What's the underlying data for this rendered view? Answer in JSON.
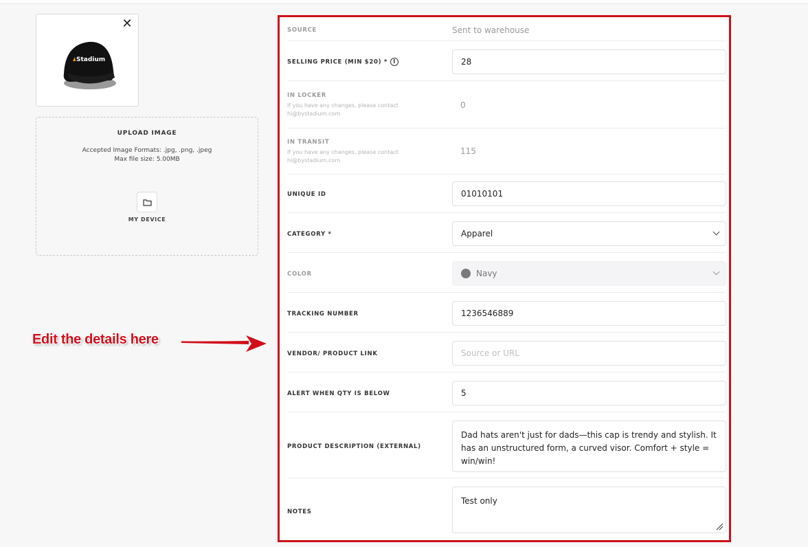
{
  "thumbnail": {
    "logo_text": "Stadium",
    "close_symbol": "✕"
  },
  "upload": {
    "title": "UPLOAD IMAGE",
    "formats": "Accepted Image Formats: .jpg, .png, .jpeg",
    "max_size": "Max file size: 5.00MB",
    "device_label": "MY DEVICE",
    "device_icon": "folder-icon"
  },
  "annotation": {
    "text": "Edit the details here",
    "color": "#d10f1a"
  },
  "form": {
    "source": {
      "label": "SOURCE",
      "value": "Sent to warehouse"
    },
    "selling_price": {
      "label": "SELLING PRICE (MIN $20) *",
      "value": "28",
      "info_symbol": "i"
    },
    "in_locker": {
      "label": "IN LOCKER",
      "help": "If you have any changes, please contact hi@bystadium.com",
      "value": "0"
    },
    "in_transit": {
      "label": "IN TRANSIT",
      "help": "If you have any changes, please contact hi@bystadium.com",
      "value": "115"
    },
    "unique_id": {
      "label": "UNIQUE ID",
      "value": "01010101"
    },
    "category": {
      "label": "CATEGORY *",
      "value": "Apparel"
    },
    "color": {
      "label": "COLOR",
      "value": "Navy",
      "swatch": "#7a7a7a"
    },
    "tracking": {
      "label": "TRACKING NUMBER",
      "value": "1236546889"
    },
    "vendor_link": {
      "label": "VENDOR/ PRODUCT LINK",
      "placeholder": "Source or URL"
    },
    "alert_qty": {
      "label": "ALERT WHEN QTY IS BELOW",
      "value": "5"
    },
    "description": {
      "label": "PRODUCT DESCRIPTION (EXTERNAL)",
      "value": "Dad hats aren't just for dads—this cap is trendy and stylish. It has an unstructured form, a curved visor. Comfort + style = win/win!"
    },
    "notes": {
      "label": "NOTES",
      "value": "Test only"
    }
  },
  "colors": {
    "highlight_border": "#cc0f1a"
  }
}
